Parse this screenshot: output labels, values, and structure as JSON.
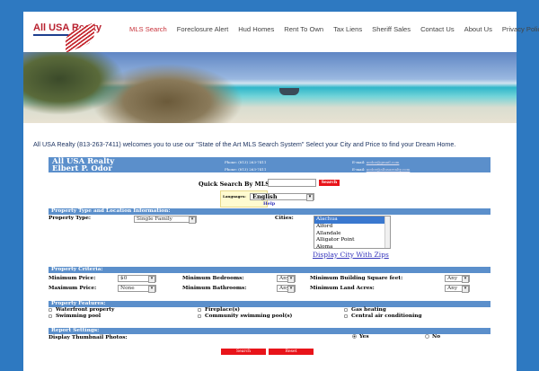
{
  "logo": {
    "text": "All USA Realty"
  },
  "nav": [
    "MLS Search",
    "Foreclosure Alert",
    "Hud Homes",
    "Rent To Own",
    "Tax Liens",
    "Sheriff Sales",
    "Contact Us",
    "About Us",
    "Privacy Policy"
  ],
  "welcome": "All USA Realty (813-263-7411) welcomes you to use our \"State of the Art MLS Search System\" Select your City and Price to find your Dream Home.",
  "agent": {
    "company": "All USA Realty",
    "name": "Elbert P. Odor",
    "phone1": "Phone: (813) 263-7411",
    "phone2": "Phone: (813) 263-7411",
    "email_label": "E-mail:",
    "email1": "aodor@gmail.com",
    "email2": "aodor@allusarealty.com"
  },
  "quick_search": {
    "label": "Quick Search By MLS ID:",
    "value": "",
    "button": "Search"
  },
  "language": {
    "label": "Languages:",
    "selected": "English",
    "help": "Help"
  },
  "sections": {
    "location": "Property Type and Location Information:",
    "criteria": "Property Criteria:",
    "features": "Property Features:",
    "report": "Report Settings:"
  },
  "location": {
    "type_label": "Property Type:",
    "type_value": "Single Family",
    "cities_label": "Cities:",
    "cities": [
      "Alachua",
      "Alford",
      "Allandale",
      "Alligator Point",
      "Aloma"
    ],
    "zips_link": "Display City With Zips"
  },
  "criteria": {
    "min_price": "Minimum Price:",
    "min_price_val": "$0",
    "max_price": "Maximum Price:",
    "max_price_val": "None",
    "min_bed": "Minimum Bedrooms:",
    "min_bed_val": "Any",
    "min_bath": "Minimum Bathrooms:",
    "min_bath_val": "Any",
    "min_sqft": "Minimum Building Square feet:",
    "min_sqft_val": "Any",
    "min_acres": "Minimum Land Acres:",
    "min_acres_val": "Any"
  },
  "features": [
    "Waterfront property",
    "Fireplace(s)",
    "Gas heating",
    "Swimming pool",
    "Community swimming pool(s)",
    "Central air conditioning"
  ],
  "report": {
    "thumb_label": "Display Thumbnail Photos:",
    "yes": "Yes",
    "no": "No"
  },
  "buttons": {
    "search": "Search",
    "reset": "Reset"
  }
}
